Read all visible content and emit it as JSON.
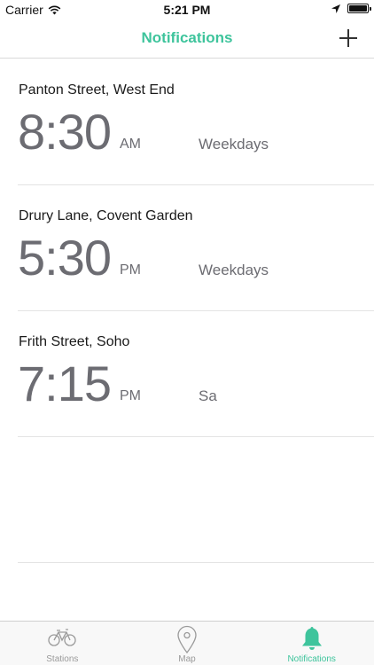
{
  "status_bar": {
    "carrier": "Carrier",
    "time": "5:21 PM"
  },
  "nav": {
    "title": "Notifications",
    "accent_color": "#3ec49c"
  },
  "notifications": [
    {
      "station": "Panton Street, West End",
      "time": "8:30",
      "ampm": "AM",
      "days": "Weekdays"
    },
    {
      "station": "Drury Lane, Covent Garden",
      "time": "5:30",
      "ampm": "PM",
      "days": "Weekdays"
    },
    {
      "station": "Frith Street, Soho",
      "time": "7:15",
      "ampm": "PM",
      "days": "Sa"
    }
  ],
  "tabs": [
    {
      "label": "Stations",
      "icon": "bicycle-icon",
      "active": false
    },
    {
      "label": "Map",
      "icon": "map-pin-icon",
      "active": false
    },
    {
      "label": "Notifications",
      "icon": "bell-icon",
      "active": true
    }
  ]
}
